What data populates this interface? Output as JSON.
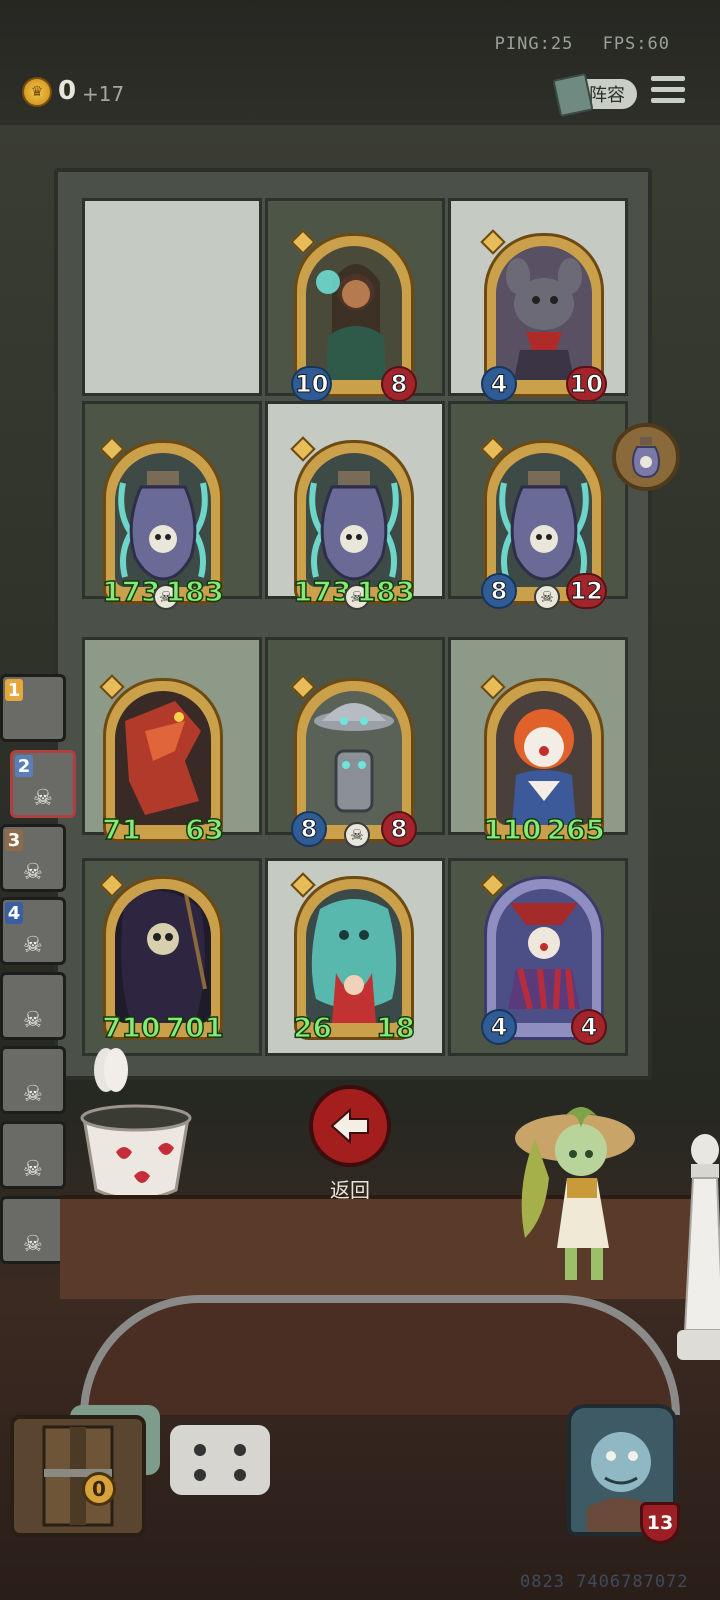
{
  "hud": {
    "ping_label": "PING:25",
    "fps_label": "FPS:60",
    "gold": "0",
    "gold_income": "+17",
    "formation_button": "阵容",
    "menu_icon": "hamburger-menu-icon"
  },
  "board": {
    "rows": [
      [
        {
          "empty": true
        },
        {
          "unit": "mystic-woman",
          "attack": "10",
          "health": "8"
        },
        {
          "unit": "rat-bandit",
          "attack": "4",
          "health": "10"
        }
      ],
      [
        {
          "unit": "soul-jar",
          "attack": "173",
          "health": "183",
          "buffed": true
        },
        {
          "unit": "soul-jar",
          "attack": "173",
          "health": "183",
          "buffed": true
        },
        {
          "unit": "soul-jar",
          "attack": "8",
          "health": "12"
        }
      ],
      [
        {
          "unit": "red-mech-dragon",
          "attack": "71",
          "health": "63",
          "buffed": true
        },
        {
          "unit": "trash-can-robot",
          "attack": "8",
          "health": "8"
        },
        {
          "unit": "knife-clown",
          "attack": "110",
          "health": "265",
          "buffed": true
        }
      ],
      [
        {
          "unit": "grim-reaper",
          "attack": "710",
          "health": "701",
          "buffed": true
        },
        {
          "unit": "ghost-wraith",
          "attack": "26",
          "health": "18",
          "buffed": true
        },
        {
          "unit": "striped-clown",
          "attack": "4",
          "health": "4",
          "card_style": "purple"
        }
      ]
    ]
  },
  "roster": [
    {
      "rank": "1",
      "color": "#e8a73a"
    },
    {
      "rank": "2",
      "color": "#5a7fb8"
    },
    {
      "rank": "3",
      "color": "#8c6a4a"
    },
    {
      "rank": "4",
      "color": "#3a5fa0"
    },
    {
      "rank": ""
    },
    {
      "rank": ""
    },
    {
      "rank": ""
    },
    {
      "rank": ""
    }
  ],
  "back_button": {
    "label": "返回"
  },
  "chest": {
    "count": "0"
  },
  "hero": {
    "health": "13"
  },
  "watermark": "0823 7406787072"
}
